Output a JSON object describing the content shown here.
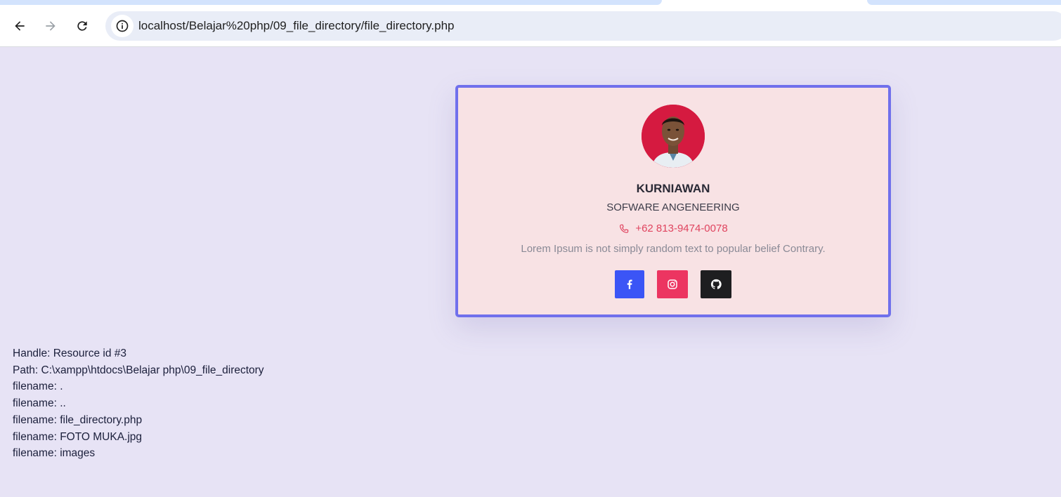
{
  "browser": {
    "url": "localhost/Belajar%20php/09_file_directory/file_directory.php",
    "back_icon": "arrow-left-icon",
    "forward_icon": "arrow-right-icon",
    "reload_icon": "reload-icon",
    "site_info_icon": "info-icon"
  },
  "profile": {
    "name": "KURNIAWAN",
    "role": "SOFWARE ANGENEERING",
    "phone": "+62 813-9474-0078",
    "description": "Lorem Ipsum is not simply random text to popular belief Contrary.",
    "social": [
      {
        "name": "facebook",
        "icon": "facebook-icon",
        "color": "#3b55f6"
      },
      {
        "name": "instagram",
        "icon": "instagram-icon",
        "color": "#ec3561"
      },
      {
        "name": "github",
        "icon": "github-icon",
        "color": "#1e1e20"
      }
    ],
    "accent_color": "#7070ec",
    "card_background": "#f8e2e4"
  },
  "output": {
    "lines": [
      "Handle: Resource id #3",
      "Path: C:\\xampp\\htdocs\\Belajar php\\09_file_directory",
      "filename: .",
      "filename: ..",
      "filename: file_directory.php",
      "filename: FOTO MUKA.jpg",
      "filename: images"
    ]
  }
}
